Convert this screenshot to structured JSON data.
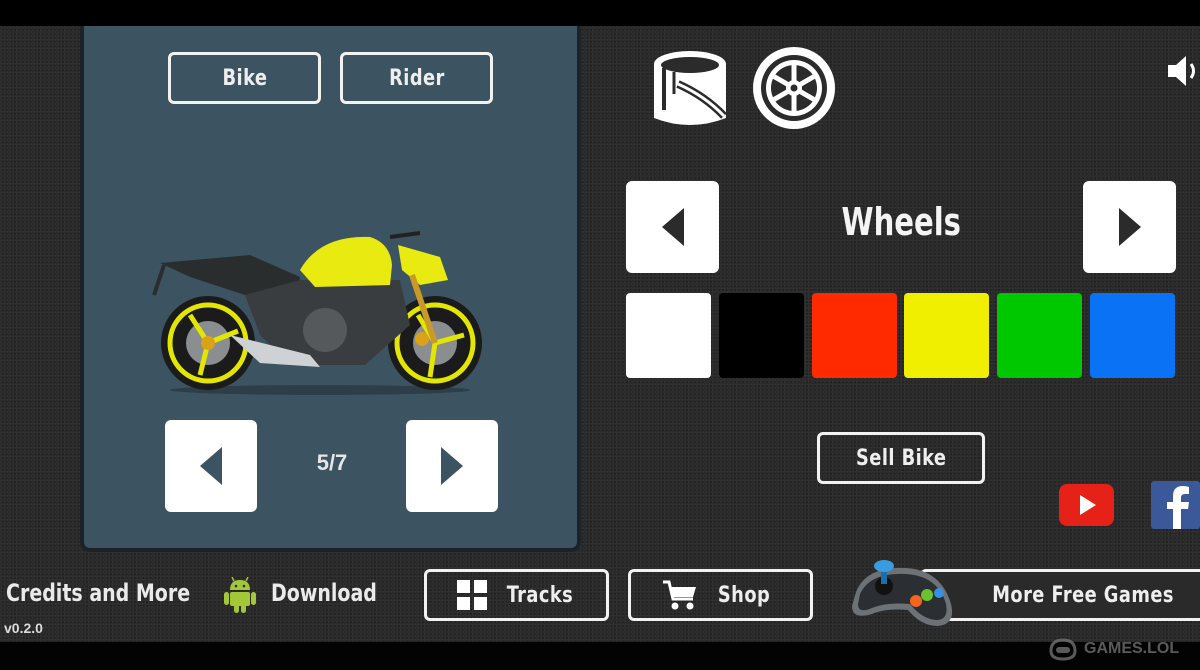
{
  "panel": {
    "tabs": [
      {
        "label": "Bike"
      },
      {
        "label": "Rider"
      }
    ],
    "bike_image": "yellow-naked-motorcycle",
    "pager": {
      "current": 5,
      "total": 7,
      "label": "5/7"
    }
  },
  "customize": {
    "tools": [
      {
        "icon": "paint-bucket-icon",
        "label": "Paint"
      },
      {
        "icon": "wheel-icon",
        "label": "Wheels"
      }
    ],
    "sound_icon": "speaker-icon",
    "category": "Wheels",
    "colors": [
      {
        "name": "white",
        "hex": "#ffffff"
      },
      {
        "name": "black",
        "hex": "#000000"
      },
      {
        "name": "red",
        "hex": "#ff2a00"
      },
      {
        "name": "yellow",
        "hex": "#f0ef00"
      },
      {
        "name": "green",
        "hex": "#00c800"
      },
      {
        "name": "blue",
        "hex": "#0a72f5"
      }
    ],
    "sell_label": "Sell Bike"
  },
  "social": {
    "youtube_color": "#e62117",
    "facebook_color": "#3b5998"
  },
  "footer": {
    "credits_label": "Credits and More",
    "download_label": "Download",
    "tracks_label": "Tracks",
    "shop_label": "Shop",
    "more_games_label": "More Free Games",
    "version": "v0.2.0"
  },
  "watermark": "GAMES.LOL"
}
